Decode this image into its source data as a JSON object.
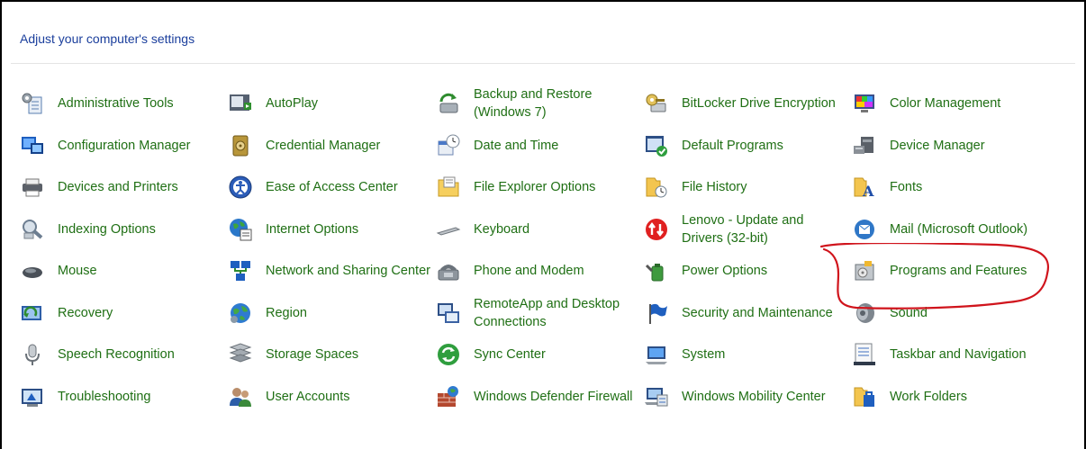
{
  "header": {
    "title": "Adjust your computer's settings"
  },
  "items": [
    {
      "label": "Administrative Tools",
      "icon": "administrative-tools-icon"
    },
    {
      "label": "AutoPlay",
      "icon": "autoplay-icon"
    },
    {
      "label": "Backup and Restore (Windows 7)",
      "icon": "backup-restore-icon"
    },
    {
      "label": "BitLocker Drive Encryption",
      "icon": "bitlocker-icon"
    },
    {
      "label": "Color Management",
      "icon": "color-management-icon"
    },
    {
      "label": "Configuration Manager",
      "icon": "configuration-manager-icon"
    },
    {
      "label": "Credential Manager",
      "icon": "credential-manager-icon"
    },
    {
      "label": "Date and Time",
      "icon": "date-time-icon"
    },
    {
      "label": "Default Programs",
      "icon": "default-programs-icon"
    },
    {
      "label": "Device Manager",
      "icon": "device-manager-icon"
    },
    {
      "label": "Devices and Printers",
      "icon": "devices-printers-icon"
    },
    {
      "label": "Ease of Access Center",
      "icon": "ease-of-access-icon"
    },
    {
      "label": "File Explorer Options",
      "icon": "file-explorer-options-icon"
    },
    {
      "label": "File History",
      "icon": "file-history-icon"
    },
    {
      "label": "Fonts",
      "icon": "fonts-icon"
    },
    {
      "label": "Indexing Options",
      "icon": "indexing-options-icon"
    },
    {
      "label": "Internet Options",
      "icon": "internet-options-icon"
    },
    {
      "label": "Keyboard",
      "icon": "keyboard-icon"
    },
    {
      "label": "Lenovo - Update and Drivers (32-bit)",
      "icon": "lenovo-update-icon"
    },
    {
      "label": "Mail (Microsoft Outlook)",
      "icon": "mail-icon"
    },
    {
      "label": "Mouse",
      "icon": "mouse-icon"
    },
    {
      "label": "Network and Sharing Center",
      "icon": "network-sharing-icon"
    },
    {
      "label": "Phone and Modem",
      "icon": "phone-modem-icon"
    },
    {
      "label": "Power Options",
      "icon": "power-options-icon"
    },
    {
      "label": "Programs and Features",
      "icon": "programs-features-icon"
    },
    {
      "label": "Recovery",
      "icon": "recovery-icon"
    },
    {
      "label": "Region",
      "icon": "region-icon"
    },
    {
      "label": "RemoteApp and Desktop Connections",
      "icon": "remoteapp-icon"
    },
    {
      "label": "Security and Maintenance",
      "icon": "security-maintenance-icon"
    },
    {
      "label": "Sound",
      "icon": "sound-icon"
    },
    {
      "label": "Speech Recognition",
      "icon": "speech-recognition-icon"
    },
    {
      "label": "Storage Spaces",
      "icon": "storage-spaces-icon"
    },
    {
      "label": "Sync Center",
      "icon": "sync-center-icon"
    },
    {
      "label": "System",
      "icon": "system-icon"
    },
    {
      "label": "Taskbar and Navigation",
      "icon": "taskbar-navigation-icon"
    },
    {
      "label": "Troubleshooting",
      "icon": "troubleshooting-icon"
    },
    {
      "label": "User Accounts",
      "icon": "user-accounts-icon"
    },
    {
      "label": "Windows Defender Firewall",
      "icon": "windows-firewall-icon"
    },
    {
      "label": "Windows Mobility Center",
      "icon": "mobility-center-icon"
    },
    {
      "label": "Work Folders",
      "icon": "work-folders-icon"
    }
  ],
  "annotation": {
    "highlighted_item": "Programs and Features",
    "color": "#d0141c"
  },
  "colors": {
    "link": "#1f6f14",
    "header": "#1a3e9c"
  }
}
